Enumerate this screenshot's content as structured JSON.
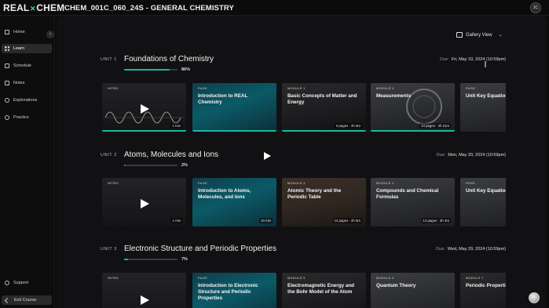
{
  "app": {
    "logo_left": "REAL",
    "logo_mark": "✕",
    "logo_right": "CHEM",
    "course_title": "CHEM_001C_060_24S - GENERAL CHEMISTRY",
    "avatar_initials": "JC"
  },
  "sidebar": {
    "items": [
      {
        "label": "Home"
      },
      {
        "label": "Learn"
      },
      {
        "label": "Schedule"
      },
      {
        "label": "Notes"
      },
      {
        "label": "Explorations"
      },
      {
        "label": "Practice"
      }
    ],
    "support_label": "Support",
    "exit_label": "Exit Course"
  },
  "toolbar": {
    "gallery_view_label": "Gallery View"
  },
  "units": [
    {
      "label": "UNIT 1",
      "title": "Foundations of Chemistry",
      "progress_pct": 86,
      "progress_text": "86%",
      "due_prefix": "Due:",
      "due_text": "Fri, May 10, 2024 (10:59pm)",
      "cards": [
        {
          "type": "INTRO",
          "title": "",
          "meta": "1 min"
        },
        {
          "type": "PAGE",
          "title": "Introduction to REAL Chemistry",
          "meta": ""
        },
        {
          "type": "MODULE 1",
          "title": "Basic Concepts of Matter and Energy",
          "meta": "8 pages · 2h 9m"
        },
        {
          "type": "MODULE 2",
          "title": "Measurements",
          "meta": "14 pages · 4h 21m"
        },
        {
          "type": "PAGE",
          "title": "Unit Key Equations and Terms",
          "meta": ""
        }
      ]
    },
    {
      "label": "UNIT 2",
      "title": "Atoms, Molecules and Ions",
      "progress_pct": 2,
      "progress_text": "2%",
      "due_prefix": "Due:",
      "due_text": "Mon, May 20, 2024 (10:59pm)",
      "cards": [
        {
          "type": "INTRO",
          "title": "",
          "meta": "1 min"
        },
        {
          "type": "PAGE",
          "title": "Introduction to Atoms, Molecules, and Ions",
          "meta": "10 min"
        },
        {
          "type": "MODULE 3",
          "title": "Atomic Theory and the Periodic Table",
          "meta": "13 pages · 2h 8m"
        },
        {
          "type": "MODULE 4",
          "title": "Compounds and Chemical Formulas",
          "meta": "14 pages · 3h 4m"
        },
        {
          "type": "PAGE",
          "title": "Unit Key Equations and Terms",
          "meta": ""
        }
      ]
    },
    {
      "label": "UNIT 3",
      "title": "Electronic Structure and Periodic Properties",
      "progress_pct": 7,
      "progress_text": "7%",
      "due_prefix": "Due:",
      "due_text": "Wed, May 29, 2024 (10:59pm)",
      "cards": [
        {
          "type": "INTRO",
          "title": "",
          "meta": ""
        },
        {
          "type": "PAGE",
          "title": "Introduction to Electronic Structure and Periodic Properties",
          "meta": ""
        },
        {
          "type": "MODULE 5",
          "title": "Electromagnetic Energy and the Bohr Model of the Atom",
          "meta": ""
        },
        {
          "type": "MODULE 6",
          "title": "Quantum Theory",
          "meta": ""
        },
        {
          "type": "MODULE 7",
          "title": "Periodic Properties",
          "meta": ""
        }
      ]
    }
  ],
  "colors": {
    "accent": "#19b79f",
    "background": "#0b0b0c",
    "panel": "#111113"
  },
  "icons": {
    "sidebar": [
      "home-icon",
      "learn-grid-icon",
      "schedule-icon",
      "notes-icon",
      "explorations-icon",
      "practice-icon",
      "support-icon",
      "exit-icon"
    ],
    "toolbar": [
      "gallery-view-icon",
      "chevron-down-icon"
    ],
    "cards": [
      "play-icon",
      "chevron-right-icon"
    ]
  }
}
